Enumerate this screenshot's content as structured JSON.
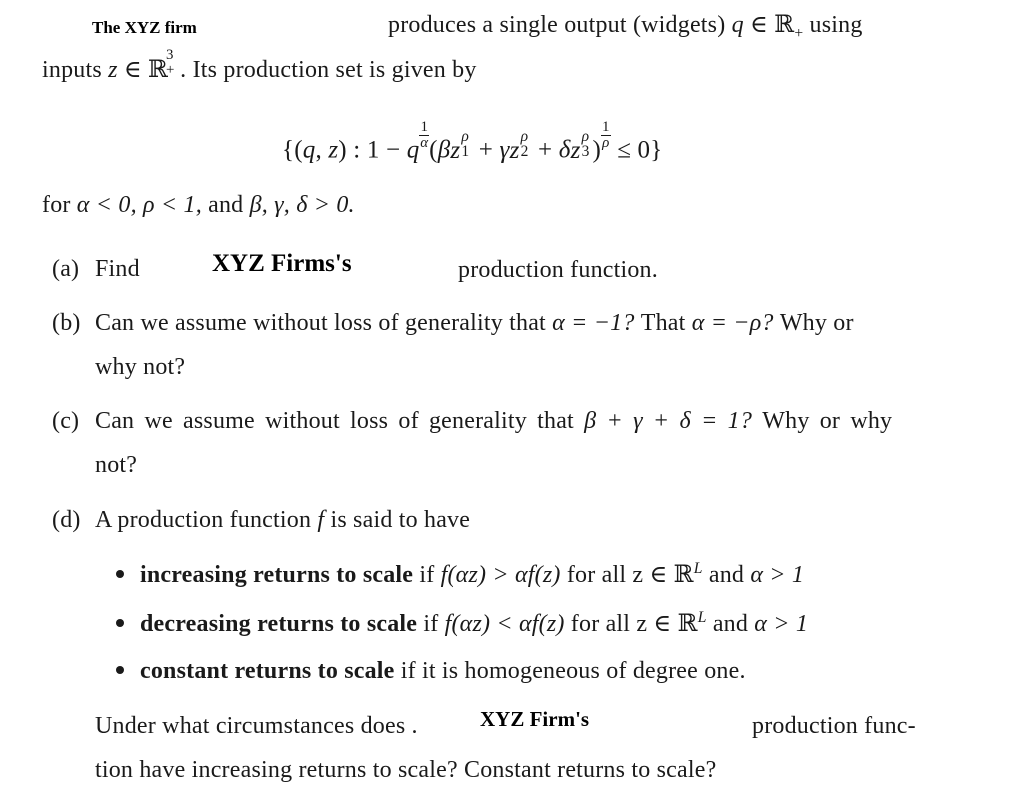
{
  "intro": {
    "overlay_label_1": "The  XYZ   firm",
    "line1_text": "produces a single output (widgets)",
    "line1_var": "q",
    "line1_in": "∈",
    "line1_set": "ℝ",
    "line1_set_sub": "+",
    "line1_end": "using",
    "line2_start": "inputs",
    "line2_var": "z",
    "line2_in": "∈",
    "line2_set": "ℝ",
    "line2_set_sup": "3",
    "line2_set_sub": "+",
    "line2_end": ". Its production set is given by"
  },
  "equation": {
    "open": "{(",
    "q": "q",
    "comma": ",",
    "z": "z",
    "close_pair": ") : 1 −",
    "q2": "q",
    "exp_num": "1",
    "exp_den": "α",
    "paren_open": "(",
    "beta": "β",
    "gamma": "γ",
    "delta": "δ",
    "zvar": "z",
    "rho": "ρ",
    "sub1": "1",
    "sub2": "2",
    "sub3": "3",
    "plus": "+",
    "paren_close": ")",
    "outer_num": "1",
    "outer_den": "ρ",
    "tail": "≤ 0}"
  },
  "conditions": {
    "text_for": "for",
    "alpha_cond": "α < 0,",
    "rho_cond": "ρ < 1,",
    "and": "and",
    "params": "β, γ, δ > 0."
  },
  "parts": {
    "a": {
      "label": "(a)",
      "text_start": "Find",
      "overlay": "XYZ  Firms's",
      "text_end": "production function."
    },
    "b": {
      "label": "(b)",
      "line1": "Can we assume without loss of generality that",
      "math1": "α = −1?",
      "mid": "That",
      "math2": "α = −ρ?",
      "end": "Why or",
      "line2": "why not?"
    },
    "c": {
      "label": "(c)",
      "line1": "Can we assume without loss of generality that",
      "math": "β + γ + δ = 1?",
      "end": "Why or why",
      "line2": "not?"
    },
    "d": {
      "label": "(d)",
      "intro": "A production function",
      "f": "f",
      "intro_end": "is said to have",
      "bullets": [
        {
          "bold": "increasing returns to scale",
          "if": "if",
          "math": "f(αz) > αf(z)",
          "forall": "for all",
          "zin": "z ∈ ℝ",
          "sup": "L",
          "and": "and",
          "cond": "α > 1"
        },
        {
          "bold": "decreasing returns to scale",
          "if": "if",
          "math": "f(αz) < αf(z)",
          "forall": "for all",
          "zin": "z ∈ ℝ",
          "sup": "L",
          "and": "and",
          "cond": "α > 1"
        },
        {
          "bold": "constant returns to scale",
          "rest": "if it is homogeneous of degree one."
        }
      ],
      "question_start": "Under what circumstances does .",
      "overlay": "XYZ  Firm's",
      "question_end": "production func-",
      "question_line2": "tion have increasing returns to scale? Constant returns to scale?"
    }
  }
}
